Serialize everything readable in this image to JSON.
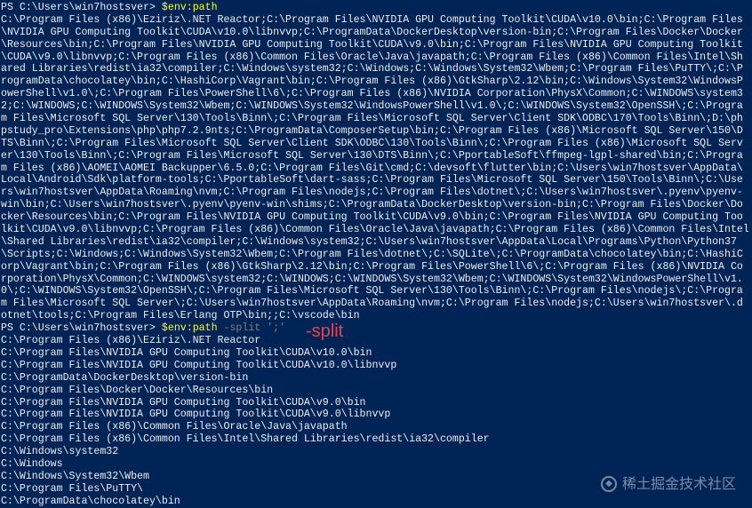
{
  "prompt1": {
    "prefix": "PS C:\\Users\\win7hostsver> ",
    "command": "$env:path"
  },
  "path_output": [
    "C:\\Program Files (x86)\\Eziriz\\.NET Reactor;C:\\Program Files\\NVIDIA GPU Computing Toolkit\\CUDA\\v10.0\\bin;C:\\Program Files",
    "\\NVIDIA GPU Computing Toolkit\\CUDA\\v10.0\\libnvvp;C:\\ProgramData\\DockerDesktop\\version-bin;C:\\Program Files\\Docker\\Docker",
    "\\Resources\\bin;C:\\Program Files\\NVIDIA GPU Computing Toolkit\\CUDA\\v9.0\\bin;C:\\Program Files\\NVIDIA GPU Computing Toolkit",
    "\\CUDA\\v9.0\\libnvvp;C:\\Program Files (x86)\\Common Files\\Oracle\\Java\\javapath;C:\\Program Files (x86)\\Common Files\\Intel\\Sh",
    "ared Libraries\\redist\\ia32\\compiler;C:\\Windows\\system32;C:\\Windows;C:\\Windows\\System32\\Wbem;C:\\Program Files\\PuTTY\\;C:\\P",
    "rogramData\\chocolatey\\bin;C:\\HashiCorp\\Vagrant\\bin;C:\\Program Files (x86)\\GtkSharp\\2.12\\bin;C:\\Windows\\System32\\WindowsP",
    "owerShell\\v1.0\\;C:\\Program Files\\PowerShell\\6\\;C:\\Program Files (x86)\\NVIDIA Corporation\\PhysX\\Common;C:\\WINDOWS\\system3",
    "2;C:\\WINDOWS;C:\\WINDOWS\\System32\\Wbem;C:\\WINDOWS\\System32\\WindowsPowerShell\\v1.0\\;C:\\WINDOWS\\System32\\OpenSSH\\;C:\\Progra",
    "m Files\\Microsoft SQL Server\\130\\Tools\\Binn\\;C:\\Program Files\\Microsoft SQL Server\\Client SDK\\ODBC\\170\\Tools\\Binn\\;D:\\ph",
    "pstudy_pro\\Extensions\\php\\php7.2.9nts;C:\\ProgramData\\ComposerSetup\\bin;C:\\Program Files (x86)\\Microsoft SQL Server\\150\\D",
    "TS\\Binn\\;C:\\Program Files\\Microsoft SQL Server\\Client SDK\\ODBC\\130\\Tools\\Binn\\;C:\\Program Files (x86)\\Microsoft SQL Serv",
    "er\\130\\Tools\\Binn\\;C:\\Program Files\\Microsoft SQL Server\\130\\DTS\\Binn\\;C:\\PportableSoft\\ffmpeg-lgpl-shared\\bin;C:\\Progra",
    "m Files (x86)\\AOMEI\\AOMEI Backupper\\6.5.0;C:\\Program Files\\Git\\cmd;C:\\devsoft\\flutter\\bin;C:\\Users\\win7hostsver\\AppData\\",
    "Local\\Android\\Sdk\\platform-tools;C:\\PportableSoft\\dart-sass;C:\\Program Files\\Microsoft SQL Server\\150\\Tools\\Binn\\;C:\\Use",
    "rs\\win7hostsver\\AppData\\Roaming\\nvm;C:\\Program Files\\nodejs;C:\\Program Files\\dotnet\\;C:\\Users\\win7hostsver\\.pyenv\\pyenv-",
    "win\\bin;C:\\Users\\win7hostsver\\.pyenv\\pyenv-win\\shims;C:\\ProgramData\\DockerDesktop\\version-bin;C:\\Program Files\\Docker\\Do",
    "cker\\Resources\\bin;C:\\Program Files\\NVIDIA GPU Computing Toolkit\\CUDA\\v9.0\\bin;C:\\Program Files\\NVIDIA GPU Computing Too",
    "lkit\\CUDA\\v9.0\\libnvvp;C:\\Program Files (x86)\\Common Files\\Oracle\\Java\\javapath;C:\\Program Files (x86)\\Common Files\\Intel",
    "\\Shared Libraries\\redist\\ia32\\compiler;C:\\Windows\\system32;C:\\Users\\win7hostsver\\AppData\\Local\\Programs\\Python\\Python37",
    "\\Scripts;C:\\Windows;C:\\Windows\\System32\\Wbem;C:\\Program Files\\dotnet\\;C:\\SQLite\\;C:\\ProgramData\\chocolatey\\bin;C:\\HashiC",
    "orp\\Vagrant\\bin;C:\\Program Files (x86)\\GtkSharp\\2.12\\bin;C:\\Program Files\\PowerShell\\6\\;C:\\Program Files (x86)\\NVIDIA Co",
    "rporation\\PhysX\\Common;C:\\WINDOWS\\system32;C:\\WINDOWS;C:\\WINDOWS\\System32\\Wbem;C:\\WINDOWS\\System32\\WindowsPowerShell\\v1.",
    "0\\;C:\\WINDOWS\\System32\\OpenSSH\\;C:\\Program Files\\Microsoft SQL Server\\130\\Tools\\Binn\\;C:\\Program Files\\nodejs\\;C:\\Progra",
    "m Files\\Microsoft SQL Server\\;C:\\Users\\win7hostsver\\AppData\\Roaming\\nvm;C:\\Program Files\\nodejs;C:\\Users\\win7hostsver\\.d",
    "otnet\\tools;C:\\Program Files\\Erlang OTP\\bin;;C:\\vscode\\bin"
  ],
  "prompt2": {
    "prefix": "PS C:\\Users\\win7hostsver> ",
    "command": "$env:path",
    "operator": " -split",
    "arg": " ';'"
  },
  "annotation_text": "-split",
  "split_output": [
    "C:\\Program Files (x86)\\Eziriz\\.NET Reactor",
    "C:\\Program Files\\NVIDIA GPU Computing Toolkit\\CUDA\\v10.0\\bin",
    "C:\\Program Files\\NVIDIA GPU Computing Toolkit\\CUDA\\v10.0\\libnvvp",
    "C:\\ProgramData\\DockerDesktop\\version-bin",
    "C:\\Program Files\\Docker\\Docker\\Resources\\bin",
    "C:\\Program Files\\NVIDIA GPU Computing Toolkit\\CUDA\\v9.0\\bin",
    "C:\\Program Files\\NVIDIA GPU Computing Toolkit\\CUDA\\v9.0\\libnvvp",
    "C:\\Program Files (x86)\\Common Files\\Oracle\\Java\\javapath",
    "C:\\Program Files (x86)\\Common Files\\Intel\\Shared Libraries\\redist\\ia32\\compiler",
    "C:\\Windows\\system32",
    "C:\\Windows",
    "C:\\Windows\\System32\\Wbem",
    "C:\\Program Files\\PuTTY\\",
    "C:\\ProgramData\\chocolatey\\bin"
  ],
  "watermark": "稀土掘金技术社区",
  "colors": {
    "background": "#012456",
    "text": "#eeedf0",
    "command": "#ffff00",
    "operator": "#808080",
    "annotation": "#e8434f"
  }
}
